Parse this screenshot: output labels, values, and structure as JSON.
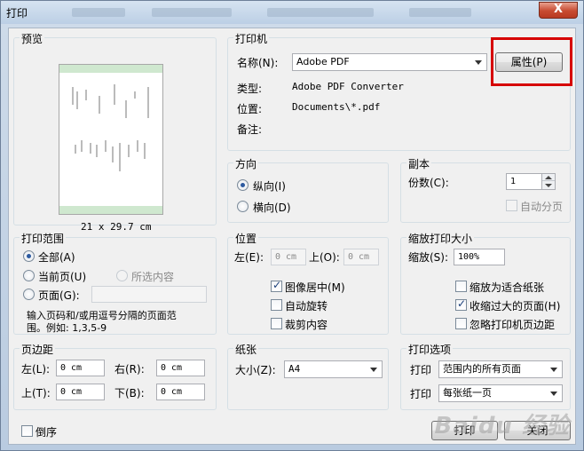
{
  "window": {
    "title": "打印",
    "close": "X"
  },
  "preview": {
    "title": "预览",
    "page_size": "21 x 29.7 cm"
  },
  "printer": {
    "title": "打印机",
    "name_label": "名称(N):",
    "name_value": "Adobe PDF",
    "properties_button": "属性(P)",
    "type_label": "类型:",
    "type_value": "Adobe PDF Converter",
    "location_label": "位置:",
    "location_value": "Documents\\*.pdf",
    "comment_label": "备注:"
  },
  "orientation": {
    "title": "方向",
    "portrait": "纵向(I)",
    "landscape": "横向(D)"
  },
  "copies": {
    "title": "副本",
    "count_label": "份数(C):",
    "count_value": "1",
    "collate": "自动分页"
  },
  "range": {
    "title": "打印范围",
    "all": "全部(A)",
    "current_page": "当前页(U)",
    "selection": "所选内容",
    "pages": "页面(G):",
    "hint_line1": "输入页码和/或用逗号分隔的页面范",
    "hint_line2": "围。例如: 1,3,5-9"
  },
  "position": {
    "title": "位置",
    "left_label": "左(E):",
    "left_value": "0 cm",
    "top_label": "上(O):",
    "top_value": "0 cm",
    "center_image": "图像居中(M)",
    "auto_rotate": "自动旋转",
    "crop_content": "裁剪内容"
  },
  "scale": {
    "title": "缩放打印大小",
    "scale_label": "缩放(S):",
    "scale_value": "100%",
    "fit_media": "缩放为适合纸张",
    "shrink_large": "收缩过大的页面(H)",
    "ignore_margins": "忽略打印机页边距"
  },
  "margins": {
    "title": "页边距",
    "left_label": "左(L):",
    "left_value": "0 cm",
    "right_label": "右(R):",
    "right_value": "0 cm",
    "top_label": "上(T):",
    "top_value": "0 cm",
    "bottom_label": "下(B):",
    "bottom_value": "0 cm"
  },
  "paper": {
    "title": "纸张",
    "size_label": "大小(Z):",
    "size_value": "A4"
  },
  "options": {
    "title": "打印选项",
    "print_label_1": "打印",
    "print_value_1": "范围内的所有页面",
    "print_label_2": "打印",
    "print_value_2": "每张纸一页"
  },
  "footer": {
    "reverse": "倒序",
    "print_button": "打印",
    "close_button": "关闭"
  },
  "colors": {
    "highlight": "#d60000",
    "accent": "#2d5aa0"
  },
  "watermark": "Baidu 经验"
}
